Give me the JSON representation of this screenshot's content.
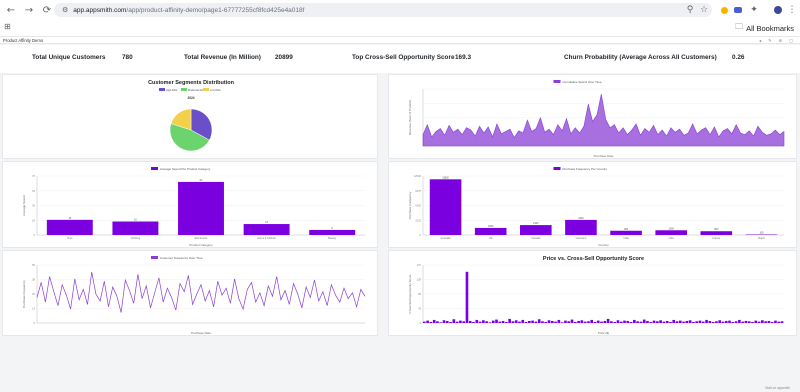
{
  "browser": {
    "url_host": "app.appsmith.com",
    "url_path": "/app/product-affinity-demo/page1-67777255cf8fcd425e4a018f",
    "all_bookmarks": "All Bookmarks"
  },
  "app": {
    "name": "Product Affinity Demo"
  },
  "stats": [
    {
      "label": "Total Unique Customers",
      "value": "780"
    },
    {
      "label": "Total Revenue (In Million)",
      "value": "20899"
    },
    {
      "label": "Top Cross-Sell Opportunity Score",
      "value": "169.3"
    },
    {
      "label": "Churn Probability (Average Across All Customers)",
      "value": "0.26"
    }
  ],
  "chart_data": [
    {
      "type": "pie",
      "title": "Customer Segments Distribution",
      "subtitle": "2024",
      "legend": [
        "High Risk",
        "Moderate Risk",
        "Low Risk"
      ],
      "values": [
        33,
        47,
        20
      ],
      "colors": [
        "#6a4fc9",
        "#6cd46c",
        "#f2d04a"
      ]
    },
    {
      "type": "area",
      "title": "Cumulative Spend Over Time",
      "xlabel": "Purchase Date",
      "ylabel": "Revenue (Sum of Product)",
      "values": [
        1.5,
        2.8,
        1.2,
        1.9,
        2.3,
        1.4,
        2.7,
        1.8,
        2.2,
        1.5,
        2.4,
        2.1,
        1.3,
        2.6,
        1.7,
        2.5,
        1.2,
        2.9,
        1.6,
        1.9,
        2.2,
        1.1,
        2.0,
        1.7,
        3.4,
        1.9,
        2.3,
        3.7,
        1.8,
        2.2,
        1.5,
        2.8,
        2.0,
        3.6,
        1.6,
        2.4,
        1.7,
        2.6,
        5.5,
        3.2,
        4.1,
        6.8,
        3.5,
        2.4,
        2.8,
        1.7,
        2.4,
        1.5,
        2.1,
        2.9,
        1.4,
        2.3,
        1.8,
        2.7,
        1.5,
        2.1,
        1.3,
        2.4,
        1.8,
        2.2,
        1.4,
        1.7,
        2.9,
        1.6,
        2.1,
        2.4,
        1.5,
        2.5,
        1.2,
        2.0,
        2.3,
        1.6,
        2.8,
        1.7,
        1.5,
        2.0,
        1.3,
        2.6,
        1.8,
        1.4,
        1.6,
        2.1,
        1.5,
        1.9
      ],
      "color": "#8a3fd6"
    },
    {
      "type": "bar",
      "title": "Average Spend Per Product Category",
      "xlabel": "Product Category",
      "ylabel": "Average Spend",
      "categories": [
        "Toys",
        "Clothing",
        "Electronics",
        "Home & Kitchen",
        "Beauty"
      ],
      "values": [
        18,
        16,
        63,
        13,
        6
      ],
      "ylim": [
        0,
        70
      ],
      "color": "#7b00e0"
    },
    {
      "type": "bar",
      "title": "Purchase Frequency Per Country",
      "xlabel": "Country",
      "ylabel": "Purchase Frequency",
      "categories": [
        "Australia",
        "UK",
        "Canada",
        "Germany",
        "India",
        "USA",
        "France",
        "Brazil"
      ],
      "values": [
        11800,
        1500,
        2100,
        3200,
        900,
        1000,
        800,
        100
      ],
      "ylim": [
        0,
        12500
      ],
      "color": "#7b00e0"
    },
    {
      "type": "line",
      "title": "Customer Frequency Over Time",
      "xlabel": "Purchase Date",
      "ylabel": "Purchase Frequency",
      "values": [
        22,
        35,
        18,
        40,
        27,
        15,
        33,
        24,
        12,
        38,
        20,
        29,
        16,
        44,
        25,
        19,
        36,
        14,
        31,
        23,
        9,
        37,
        28,
        17,
        42,
        21,
        32,
        13,
        26,
        39,
        18,
        30,
        22,
        11,
        34,
        27,
        41,
        16,
        25,
        33,
        19,
        28,
        14,
        36,
        24,
        30,
        17,
        38,
        21,
        12,
        29,
        35,
        18,
        26,
        15,
        32,
        23,
        40,
        20,
        28,
        16,
        34,
        25,
        13,
        31,
        22,
        37,
        19,
        27,
        15,
        33,
        24,
        18,
        30,
        21,
        26,
        14,
        29,
        23
      ],
      "ylim": [
        0,
        50
      ],
      "color": "#8a3fd6"
    },
    {
      "type": "bar",
      "title": "Price vs. Cross-Sell Opportunity Score",
      "xlabel": "Price ($)",
      "ylabel": "Cross-Sell Opportunity Score",
      "values": [
        4,
        7,
        3,
        9,
        5,
        2,
        8,
        6,
        3,
        11,
        4,
        7,
        5,
        150,
        6,
        3,
        9,
        4,
        8,
        5,
        2,
        7,
        10,
        4,
        6,
        3,
        12,
        5,
        8,
        4,
        9,
        3,
        6,
        7,
        4,
        11,
        5,
        3,
        8,
        6,
        4,
        9,
        2,
        7,
        5,
        10,
        3,
        6,
        8,
        4,
        5,
        9,
        3,
        7,
        4,
        6,
        12,
        5,
        3,
        8,
        4,
        7,
        6,
        3,
        9,
        5,
        4,
        10,
        6,
        3,
        7,
        5,
        8,
        4,
        6,
        3,
        9,
        5,
        7,
        4,
        6,
        8,
        3,
        5,
        7,
        4,
        9,
        6,
        3,
        5,
        8,
        4,
        6,
        7,
        3,
        5,
        9,
        4,
        6,
        5,
        3,
        7,
        4,
        8,
        5,
        6,
        3,
        7,
        4,
        5
      ],
      "ylim": [
        0,
        170
      ],
      "color": "#7b00e0"
    }
  ],
  "footer": "Built on appsmith"
}
